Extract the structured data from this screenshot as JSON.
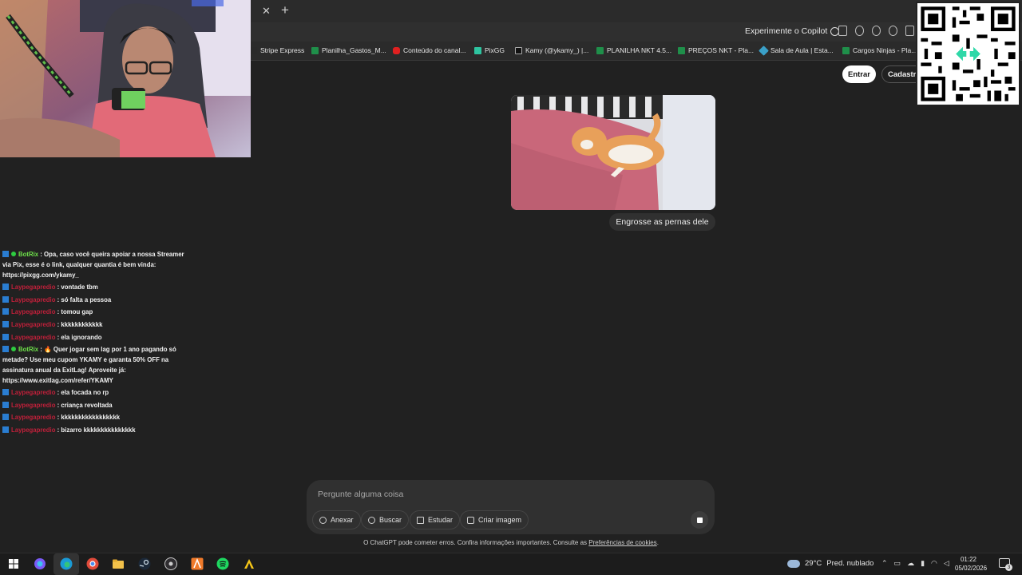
{
  "browser": {
    "tab_close": "✕",
    "tab_new": "+",
    "copilot_label": "Experimente o Copilot",
    "bookmarks": [
      {
        "label": "Stripe Express",
        "color": "#2a2a2a"
      },
      {
        "label": "Planilha_Gastos_M...",
        "color": "#1f8f4a"
      },
      {
        "label": "Conteúdo do canal...",
        "color": "#e02020"
      },
      {
        "label": "PixGG",
        "color": "#2ec4a0"
      },
      {
        "label": "Kamy (@ykamy_) |...",
        "color": "#111111"
      },
      {
        "label": "PLANILHA NKT 4.5...",
        "color": "#1f8f4a"
      },
      {
        "label": "PREÇOS NKT - Pla...",
        "color": "#1f8f4a"
      },
      {
        "label": "Sala de Aula | Esta...",
        "color": "#3aa0c8"
      },
      {
        "label": "Cargos Ninjas - Pla...",
        "color": "#1f8f4a"
      }
    ]
  },
  "header": {
    "login_label": "Entrar",
    "signup_label": "Cadastre"
  },
  "conversation": {
    "user_message": "Engrosse as pernas dele"
  },
  "composer": {
    "placeholder": "Pergunte alguma coisa",
    "attach_label": "Anexar",
    "search_label": "Buscar",
    "study_label": "Estudar",
    "image_label": "Criar imagem"
  },
  "disclaimer": {
    "text": "O ChatGPT pode cometer erros. Confira informações importantes. Consulte as",
    "link": "Preferências de cookies",
    "end": "."
  },
  "chat": {
    "messages": [
      {
        "user": "BotRix",
        "bot": true,
        "text": ": Opa, caso você queira apoiar a nossa Streamer via Pix, esse é o link, qualquer quantia é bem vinda: https://pixgg.com/ykamy_"
      },
      {
        "user": "Laypegapredio",
        "bot": false,
        "text": ": vontade tbm"
      },
      {
        "user": "Laypegapredio",
        "bot": false,
        "text": ": só falta a pessoa"
      },
      {
        "user": "Laypegapredio",
        "bot": false,
        "text": ": tomou gap"
      },
      {
        "user": "Laypegapredio",
        "bot": false,
        "text": ": kkkkkkkkkkkk"
      },
      {
        "user": "Laypegapredio",
        "bot": false,
        "text": ": ela ignorando"
      },
      {
        "user": "BotRix",
        "bot": true,
        "text": ": 🔥 Quer jogar sem lag por 1 ano pagando só metade? Use meu cupom YKAMY e garanta 50% OFF na assinatura anual da ExitLag! Aproveite já: https://www.exitlag.com/refer/YKAMY"
      },
      {
        "user": "Laypegapredio",
        "bot": false,
        "text": ": ela focada no rp"
      },
      {
        "user": "Laypegapredio",
        "bot": false,
        "text": ": criança revoltada"
      },
      {
        "user": "Laypegapredio",
        "bot": false,
        "text": ": kkkkkkkkkkkkkkkkk"
      },
      {
        "user": "Laypegapredio",
        "bot": false,
        "text": ": bizarro kkkkkkkkkkkkkkk"
      }
    ]
  },
  "taskbar": {
    "temperature": "29°C",
    "weather": "Pred. nublado",
    "time": "01:22",
    "date": "05/02/2026",
    "notifications": "3"
  }
}
